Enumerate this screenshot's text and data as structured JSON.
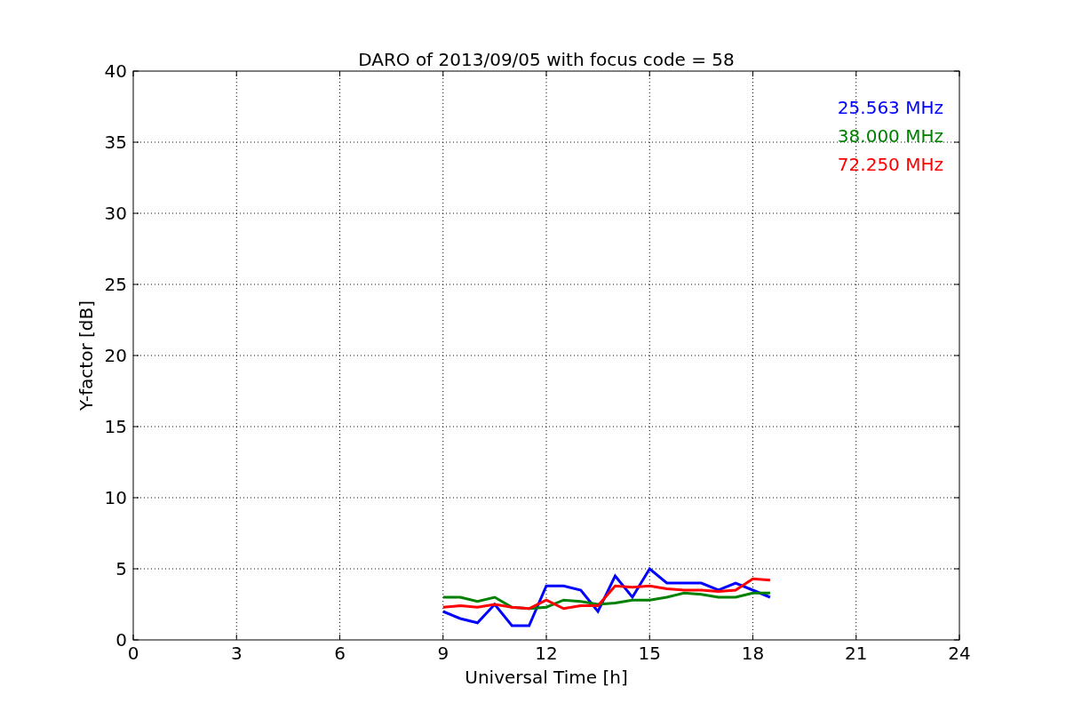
{
  "chart_data": {
    "type": "line",
    "title": "DARO of 2013/09/05 with focus code = 58",
    "xlabel": "Universal Time [h]",
    "ylabel": "Y-factor [dB]",
    "x": [
      9,
      9.5,
      10,
      10.5,
      11,
      11.5,
      12,
      12.5,
      13,
      13.5,
      14,
      14.5,
      15,
      15.5,
      16,
      16.5,
      17,
      17.5,
      18,
      18.5
    ],
    "series": [
      {
        "name": "25.563 MHz",
        "color": "#0000ff",
        "values": [
          2.0,
          1.5,
          1.2,
          2.5,
          1.0,
          1.0,
          3.8,
          3.8,
          3.5,
          2.0,
          4.5,
          3.0,
          5.0,
          4.0,
          4.0,
          4.0,
          3.5,
          4.0,
          3.5,
          3.0
        ]
      },
      {
        "name": "38.000 MHz",
        "color": "#008000",
        "values": [
          3.0,
          3.0,
          2.7,
          3.0,
          2.3,
          2.2,
          2.3,
          2.8,
          2.7,
          2.5,
          2.6,
          2.8,
          2.8,
          3.0,
          3.3,
          3.2,
          3.0,
          3.0,
          3.3,
          3.3
        ]
      },
      {
        "name": "72.250 MHz",
        "color": "#ff0000",
        "values": [
          2.3,
          2.4,
          2.3,
          2.5,
          2.3,
          2.2,
          2.8,
          2.2,
          2.4,
          2.4,
          3.8,
          3.7,
          3.8,
          3.6,
          3.5,
          3.5,
          3.4,
          3.5,
          4.3,
          4.2
        ]
      }
    ],
    "xlim": [
      0,
      24
    ],
    "ylim": [
      0,
      40
    ],
    "xticks": [
      0,
      3,
      6,
      9,
      12,
      15,
      18,
      21,
      24
    ],
    "yticks": [
      0,
      5,
      10,
      15,
      20,
      25,
      30,
      35,
      40
    ],
    "grid": true
  }
}
